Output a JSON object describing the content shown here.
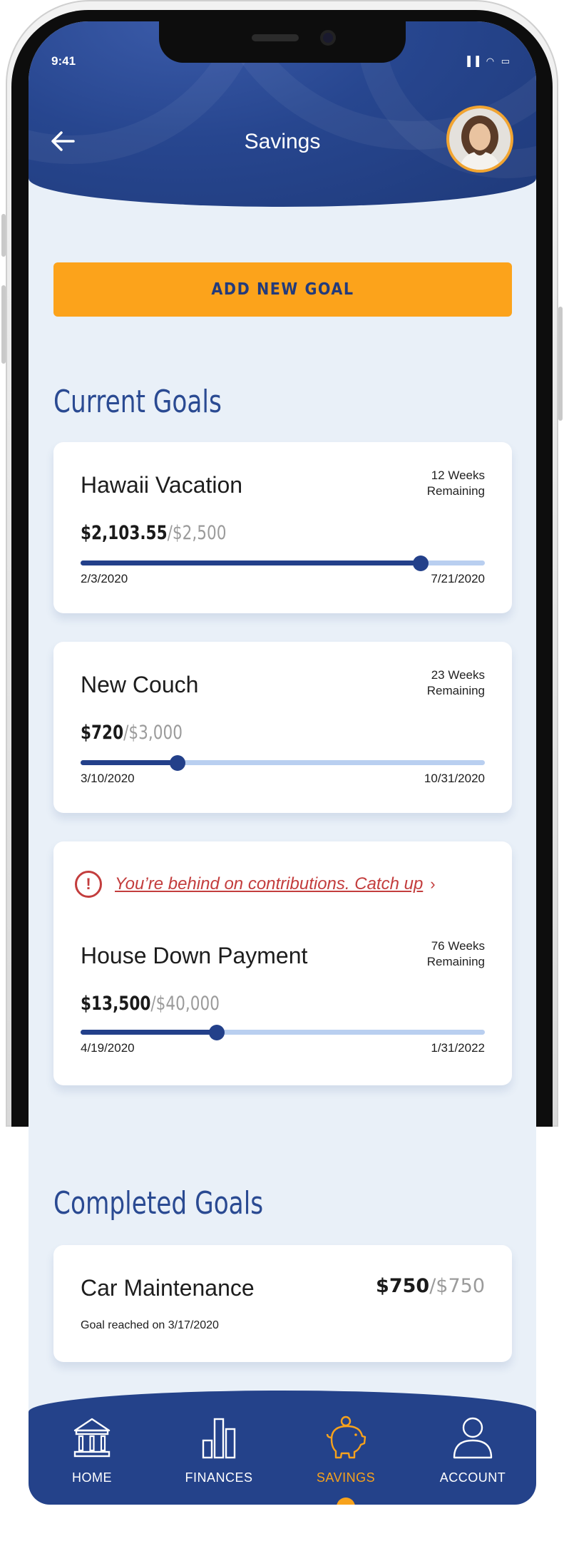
{
  "status_bar": {
    "time": "9:41",
    "icons": "▐▐ ◠ ▭"
  },
  "header": {
    "title": "Savings",
    "back_icon": "arrow-left-icon"
  },
  "add_goal": {
    "label": "ADD NEW GOAL"
  },
  "current_goals": {
    "title": "Current Goals",
    "goals": [
      {
        "name": "Hawaii Vacation",
        "remaining_line1": "12 Weeks",
        "remaining_line2": "Remaining",
        "saved": "$2,103.55",
        "target": "/$2,500",
        "progress": 0.8414,
        "start_date": "2/3/2020",
        "end_date": "7/21/2020"
      },
      {
        "name": "New Couch",
        "remaining_line1": "23 Weeks",
        "remaining_line2": "Remaining",
        "saved": "$720",
        "target": "/$3,000",
        "progress": 0.24,
        "start_date": "3/10/2020",
        "end_date": "10/31/2020"
      },
      {
        "warning": "You’re behind on contributions. Catch up",
        "warning_chevron": "›",
        "name": "House Down Payment",
        "remaining_line1": "76 Weeks",
        "remaining_line2": "Remaining",
        "saved": "$13,500",
        "target": "/$40,000",
        "progress": 0.3375,
        "start_date": "4/19/2020",
        "end_date": "1/31/2022"
      }
    ]
  },
  "completed_goals": {
    "title": "Completed Goals",
    "goals": [
      {
        "name": "Car Maintenance",
        "saved": "$750",
        "target": "/$750",
        "reached": "Goal reached on 3/17/2020"
      }
    ]
  },
  "bottom_nav": {
    "items": [
      {
        "label": "HOME",
        "icon": "bank-icon"
      },
      {
        "label": "FINANCES",
        "icon": "bar-chart-icon"
      },
      {
        "label": "SAVINGS",
        "icon": "piggy-bank-icon",
        "active": true
      },
      {
        "label": "ACCOUNT",
        "icon": "user-icon"
      }
    ]
  },
  "colors": {
    "primary": "#24428a",
    "accent": "#fca31b",
    "progress_track": "#b9cff0",
    "warning": "#c33d3d",
    "background": "#e9f0f8"
  }
}
